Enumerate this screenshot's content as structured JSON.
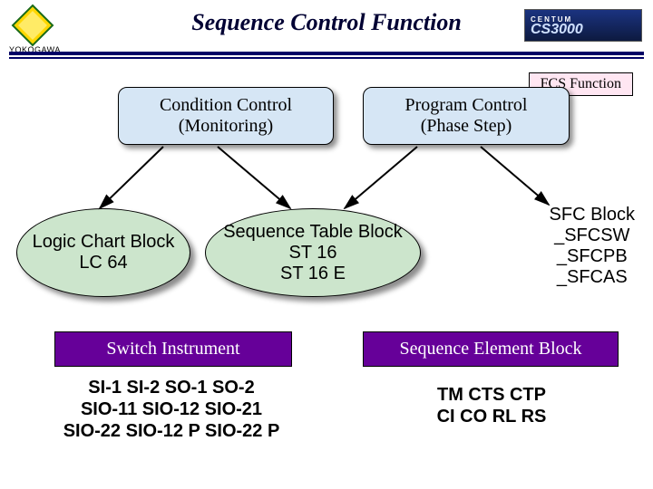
{
  "header": {
    "logo_label": "YOKOGAWA",
    "title": "Sequence Control Function",
    "centum_top": "CENTUM",
    "centum_main": "CS3000"
  },
  "diagram": {
    "fcs_function": "FCS Function",
    "condition_control_l1": "Condition Control",
    "condition_control_l2": "(Monitoring)",
    "program_control_l1": "Program Control",
    "program_control_l2": "(Phase Step)",
    "logic_chart_l1": "Logic Chart Block",
    "logic_chart_l2": "LC 64",
    "seq_table_l1": "Sequence Table Block",
    "seq_table_l2": "ST 16",
    "seq_table_l3": "ST 16 E",
    "sfc_l1": "SFC Block",
    "sfc_l2": "_SFCSW",
    "sfc_l3": "_SFCPB",
    "sfc_l4": "_SFCAS",
    "switch_instrument": "Switch Instrument",
    "sequence_element": "Sequence Element Block",
    "switch_items_l1": "SI-1   SI-2   SO-1   SO-2",
    "switch_items_l2": "SIO-11   SIO-12   SIO-21",
    "switch_items_l3": "SIO-22   SIO-12 P   SIO-22 P",
    "seq_elem_items_l1": "TM   CTS   CTP",
    "seq_elem_items_l2": "CI   CO   RL   RS"
  }
}
